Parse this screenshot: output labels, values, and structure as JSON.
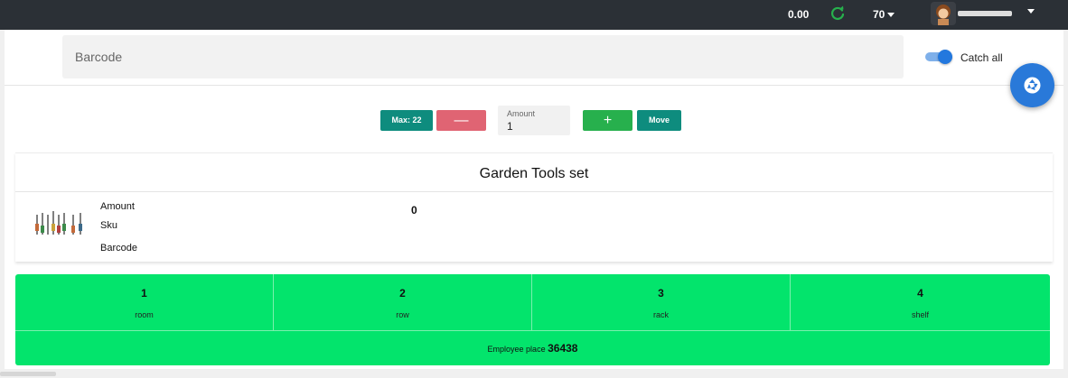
{
  "header": {
    "balance": "0.00",
    "count": "70",
    "accent_color": "#27b04d"
  },
  "scan": {
    "barcode_placeholder": "Barcode",
    "catch_all_label": "Catch all",
    "catch_all_on": true
  },
  "controls": {
    "max_label": "Max: 22",
    "minus_label": "—",
    "amount_label": "Amount",
    "amount_value": "1",
    "plus_label": "+",
    "move_label": "Move"
  },
  "product": {
    "title": "Garden Tools set",
    "fields": [
      "Amount",
      "Sku",
      "Barcode"
    ],
    "amount_value": "0"
  },
  "location": {
    "cells": [
      {
        "value": "1",
        "name": "room"
      },
      {
        "value": "2",
        "name": "row"
      },
      {
        "value": "3",
        "name": "rack"
      },
      {
        "value": "4",
        "name": "shelf"
      }
    ],
    "employee_place_label": "Employee place",
    "employee_place_value": "36438",
    "color": "#03e46c"
  }
}
